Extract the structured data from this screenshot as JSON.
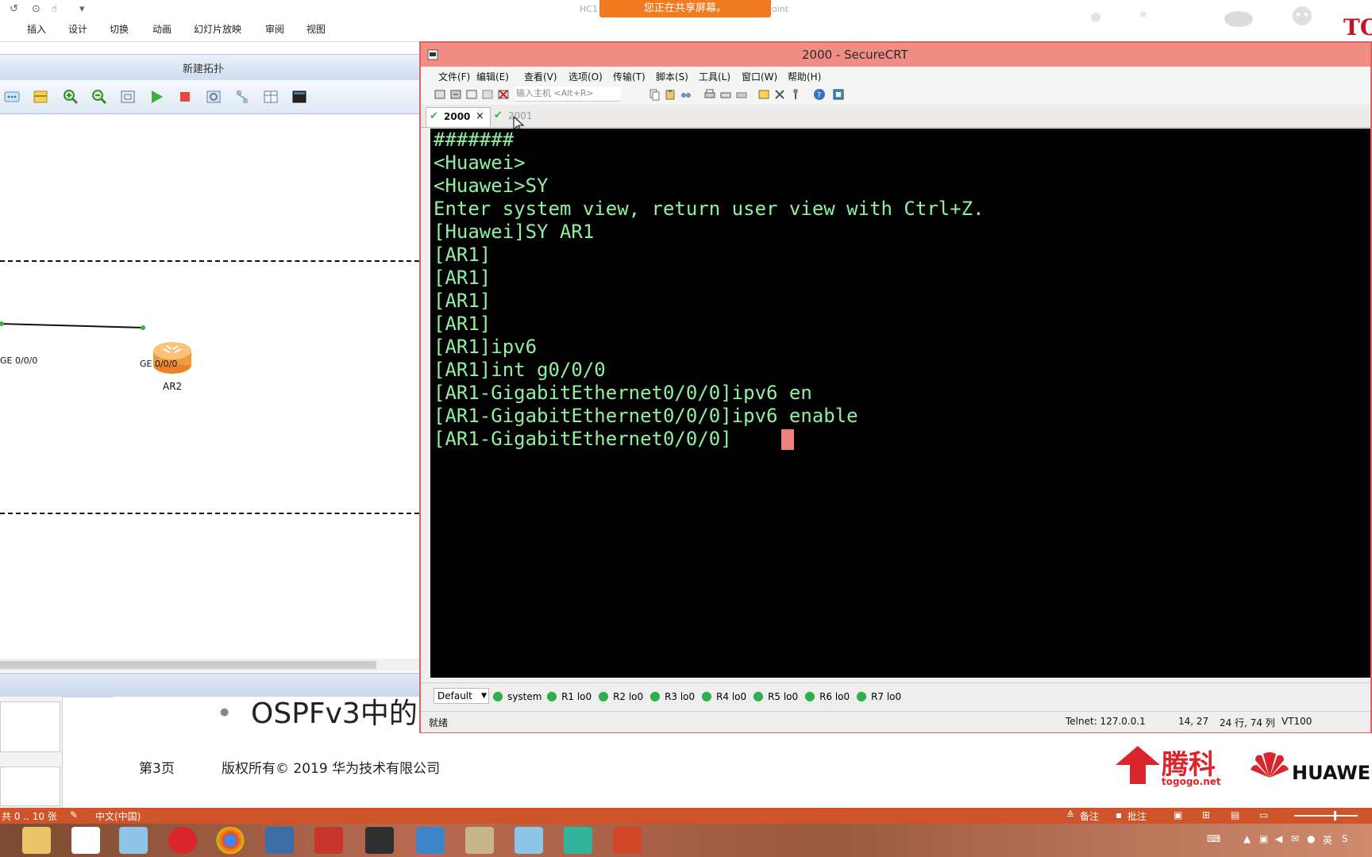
{
  "ppt": {
    "menu": [
      "插入",
      "设计",
      "切换",
      "动画",
      "幻灯片放映",
      "审阅",
      "视图"
    ],
    "share_banner": "您正在共享屏幕。",
    "title_left": "HC1",
    "title_right": "oint",
    "brand_top": "TO",
    "status_pages": "共 0 .. 10 张",
    "status_lang": "中文(中国)",
    "status_notes": "备注",
    "status_comments": "批注",
    "tray_ime": "英"
  },
  "ensp": {
    "title": "新建拓扑",
    "links": {
      "left_port": "GE 0/0/0",
      "right_port": "GE 0/0/0"
    },
    "router_name": "AR2"
  },
  "slide": {
    "bullet": "OSPFv3中的",
    "page": "第3页",
    "copyright": "版权所有© 2019 华为技术有限公司",
    "logo_cn": "腾科",
    "logo_url": "togogo.net",
    "huawei": "HUAWEI"
  },
  "crt": {
    "title": "2000 - SecureCRT",
    "menu": [
      "文件(F)",
      "编辑(E)",
      "查看(V)",
      "选项(O)",
      "传输(T)",
      "脚本(S)",
      "工具(L)",
      "窗口(W)",
      "帮助(H)"
    ],
    "host_placeholder": "输入主机 <Alt+R>",
    "tabs": [
      {
        "label": "2000",
        "active": true,
        "close": "×"
      },
      {
        "label": "2001",
        "active": false
      }
    ],
    "terminal_lines": [
      "#######",
      "<Huawei>",
      "<Huawei>SY",
      "Enter system view, return user view with Ctrl+Z.",
      "[Huawei]SY AR1",
      "[AR1]",
      "[AR1]",
      "[AR1]",
      "[AR1]",
      "[AR1]ipv6",
      "[AR1]int g0/0/0",
      "[AR1-GigabitEthernet0/0/0]ipv6 en",
      "[AR1-GigabitEthernet0/0/0]ipv6 enable",
      "[AR1-GigabitEthernet0/0/0]"
    ],
    "session_select": "Default",
    "buttons": [
      "system",
      "R1 lo0",
      "R2 lo0",
      "R3 lo0",
      "R4 lo0",
      "R5 lo0",
      "R6 lo0",
      "R7 lo0"
    ],
    "status": {
      "ready": "就绪",
      "connection": "Telnet: 127.0.0.1",
      "cursor_pos": "14,  27",
      "size": "24 行, 74 列",
      "emulation": "VT100"
    }
  },
  "colors": {
    "terminal_fg": "#8ff0a0",
    "crt_title_bg": "#f08e86",
    "share_banner": "#f07a1f",
    "ppt_status": "#d0542a"
  }
}
